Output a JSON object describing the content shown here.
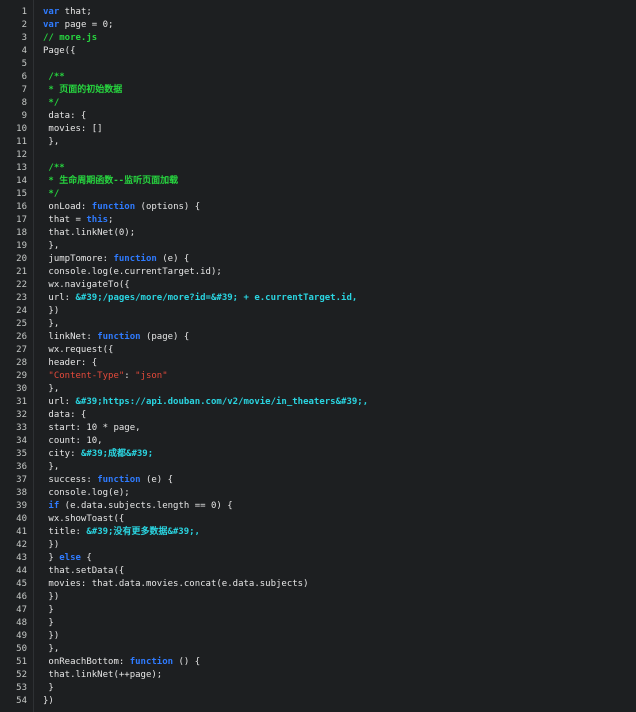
{
  "editor": {
    "colors": {
      "background": "#1d1f21",
      "text": "#e6e6e6",
      "keyword": "#2f7bff",
      "comment": "#27d43f",
      "string": "#2ad4e0",
      "string_red": "#e54a3b"
    },
    "lines": [
      {
        "n": "1",
        "segments": [
          {
            "t": "kw",
            "v": "var"
          },
          {
            "t": "p",
            "v": " that;"
          }
        ]
      },
      {
        "n": "2",
        "segments": [
          {
            "t": "kw",
            "v": "var"
          },
          {
            "t": "p",
            "v": " page = 0;"
          }
        ]
      },
      {
        "n": "3",
        "segments": [
          {
            "t": "cm",
            "v": "// more.js"
          }
        ]
      },
      {
        "n": "4",
        "segments": [
          {
            "t": "p",
            "v": "Page({"
          }
        ]
      },
      {
        "n": "5",
        "segments": []
      },
      {
        "n": "6",
        "segments": [
          {
            "t": "cm",
            "v": " /**"
          }
        ]
      },
      {
        "n": "7",
        "segments": [
          {
            "t": "cm",
            "v": " * 页面的初始数据"
          }
        ]
      },
      {
        "n": "8",
        "segments": [
          {
            "t": "cm",
            "v": " */"
          }
        ]
      },
      {
        "n": "9",
        "segments": [
          {
            "t": "p",
            "v": " data: {"
          }
        ]
      },
      {
        "n": "10",
        "segments": [
          {
            "t": "p",
            "v": " movies: []"
          }
        ]
      },
      {
        "n": "11",
        "segments": [
          {
            "t": "p",
            "v": " },"
          }
        ]
      },
      {
        "n": "12",
        "segments": []
      },
      {
        "n": "13",
        "segments": [
          {
            "t": "cm",
            "v": " /**"
          }
        ]
      },
      {
        "n": "14",
        "segments": [
          {
            "t": "cm",
            "v": " * 生命周期函数--监听页面加载"
          }
        ]
      },
      {
        "n": "15",
        "segments": [
          {
            "t": "cm",
            "v": " */"
          }
        ]
      },
      {
        "n": "16",
        "segments": [
          {
            "t": "p",
            "v": " onLoad: "
          },
          {
            "t": "kw",
            "v": "function"
          },
          {
            "t": "p",
            "v": " (options) {"
          }
        ]
      },
      {
        "n": "17",
        "segments": [
          {
            "t": "p",
            "v": " that = "
          },
          {
            "t": "kw",
            "v": "this"
          },
          {
            "t": "p",
            "v": ";"
          }
        ]
      },
      {
        "n": "18",
        "segments": [
          {
            "t": "p",
            "v": " that.linkNet(0);"
          }
        ]
      },
      {
        "n": "19",
        "segments": [
          {
            "t": "p",
            "v": " },"
          }
        ]
      },
      {
        "n": "20",
        "segments": [
          {
            "t": "p",
            "v": " jumpTomore: "
          },
          {
            "t": "kw",
            "v": "function"
          },
          {
            "t": "p",
            "v": " (e) {"
          }
        ]
      },
      {
        "n": "21",
        "segments": [
          {
            "t": "p",
            "v": " console.log(e.currentTarget.id);"
          }
        ]
      },
      {
        "n": "22",
        "segments": [
          {
            "t": "p",
            "v": " wx.navigateTo({"
          }
        ]
      },
      {
        "n": "23",
        "segments": [
          {
            "t": "p",
            "v": " url: "
          },
          {
            "t": "str",
            "v": "&#39;/pages/more/more?id=&#39; + e.currentTarget.id,"
          }
        ]
      },
      {
        "n": "24",
        "segments": [
          {
            "t": "p",
            "v": " })"
          }
        ]
      },
      {
        "n": "25",
        "segments": [
          {
            "t": "p",
            "v": " },"
          }
        ]
      },
      {
        "n": "26",
        "segments": [
          {
            "t": "p",
            "v": " linkNet: "
          },
          {
            "t": "kw",
            "v": "function"
          },
          {
            "t": "p",
            "v": " (page) {"
          }
        ]
      },
      {
        "n": "27",
        "segments": [
          {
            "t": "p",
            "v": " wx.request({"
          }
        ]
      },
      {
        "n": "28",
        "segments": [
          {
            "t": "p",
            "v": " header: {"
          }
        ]
      },
      {
        "n": "29",
        "segments": [
          {
            "t": "red",
            "v": " \"Content-Type\""
          },
          {
            "t": "p",
            "v": ": "
          },
          {
            "t": "red",
            "v": "\"json\""
          }
        ]
      },
      {
        "n": "30",
        "segments": [
          {
            "t": "p",
            "v": " },"
          }
        ]
      },
      {
        "n": "31",
        "segments": [
          {
            "t": "p",
            "v": " url: "
          },
          {
            "t": "str",
            "v": "&#39;https://api.douban.com/v2/movie/in_theaters&#39;,"
          }
        ]
      },
      {
        "n": "32",
        "segments": [
          {
            "t": "p",
            "v": " data: {"
          }
        ]
      },
      {
        "n": "33",
        "segments": [
          {
            "t": "p",
            "v": " start: 10 * page,"
          }
        ]
      },
      {
        "n": "34",
        "segments": [
          {
            "t": "p",
            "v": " count: 10,"
          }
        ]
      },
      {
        "n": "35",
        "segments": [
          {
            "t": "p",
            "v": " city: "
          },
          {
            "t": "str",
            "v": "&#39;成都&#39;"
          }
        ]
      },
      {
        "n": "36",
        "segments": [
          {
            "t": "p",
            "v": " },"
          }
        ]
      },
      {
        "n": "37",
        "segments": [
          {
            "t": "p",
            "v": " success: "
          },
          {
            "t": "kw",
            "v": "function"
          },
          {
            "t": "p",
            "v": " (e) {"
          }
        ]
      },
      {
        "n": "38",
        "segments": [
          {
            "t": "p",
            "v": " console.log(e);"
          }
        ]
      },
      {
        "n": "39",
        "segments": [
          {
            "t": "kw",
            "v": " if"
          },
          {
            "t": "p",
            "v": " (e.data.subjects.length == 0) {"
          }
        ]
      },
      {
        "n": "40",
        "segments": [
          {
            "t": "p",
            "v": " wx.showToast({"
          }
        ]
      },
      {
        "n": "41",
        "segments": [
          {
            "t": "p",
            "v": " title: "
          },
          {
            "t": "str",
            "v": "&#39;没有更多数据&#39;,"
          }
        ]
      },
      {
        "n": "42",
        "segments": [
          {
            "t": "p",
            "v": " })"
          }
        ]
      },
      {
        "n": "43",
        "segments": [
          {
            "t": "p",
            "v": " } "
          },
          {
            "t": "kw",
            "v": "else"
          },
          {
            "t": "p",
            "v": " {"
          }
        ]
      },
      {
        "n": "44",
        "segments": [
          {
            "t": "p",
            "v": " that.setData({"
          }
        ]
      },
      {
        "n": "45",
        "segments": [
          {
            "t": "p",
            "v": " movies: that.data.movies.concat(e.data.subjects)"
          }
        ]
      },
      {
        "n": "46",
        "segments": [
          {
            "t": "p",
            "v": " })"
          }
        ]
      },
      {
        "n": "47",
        "segments": [
          {
            "t": "p",
            "v": " }"
          }
        ]
      },
      {
        "n": "48",
        "segments": [
          {
            "t": "p",
            "v": " }"
          }
        ]
      },
      {
        "n": "49",
        "segments": [
          {
            "t": "p",
            "v": " })"
          }
        ]
      },
      {
        "n": "50",
        "segments": [
          {
            "t": "p",
            "v": " },"
          }
        ]
      },
      {
        "n": "51",
        "segments": [
          {
            "t": "p",
            "v": " onReachBottom: "
          },
          {
            "t": "kw",
            "v": "function"
          },
          {
            "t": "p",
            "v": " () {"
          }
        ]
      },
      {
        "n": "52",
        "segments": [
          {
            "t": "p",
            "v": " that.linkNet(++page);"
          }
        ]
      },
      {
        "n": "53",
        "segments": [
          {
            "t": "p",
            "v": " }"
          }
        ]
      },
      {
        "n": "54",
        "segments": [
          {
            "t": "p",
            "v": "})"
          }
        ]
      }
    ]
  }
}
